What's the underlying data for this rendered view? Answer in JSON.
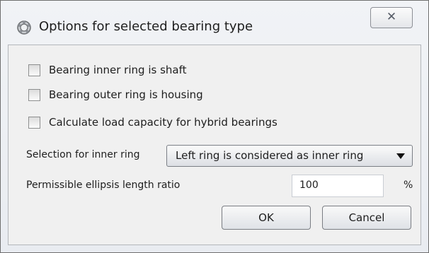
{
  "window": {
    "title": "Options for selected bearing type",
    "close_symbol": "✕",
    "app_icon": "bearing-app-icon"
  },
  "options": {
    "checkboxes": [
      {
        "label": "Bearing inner ring is shaft",
        "checked": false
      },
      {
        "label": "Bearing outer ring is housing",
        "checked": false
      },
      {
        "label": "Calculate load capacity for hybrid bearings",
        "checked": false
      }
    ],
    "inner_ring_selection": {
      "label": "Selection for inner ring",
      "value": "Left ring is considered as inner ring"
    },
    "ellipsis_ratio": {
      "label": "Permissible ellipsis length ratio",
      "value": "100",
      "unit": "%"
    }
  },
  "buttons": {
    "ok": "OK",
    "cancel": "Cancel"
  }
}
